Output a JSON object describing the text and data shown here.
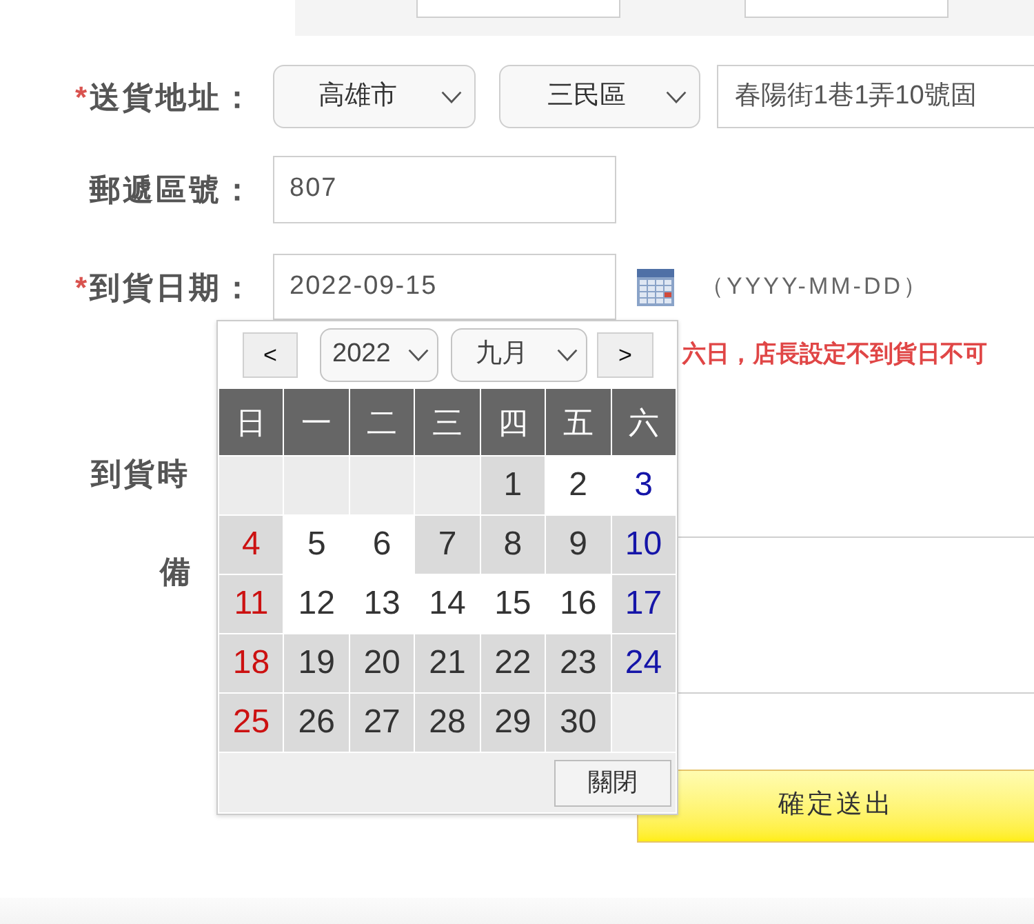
{
  "top_panel": {
    "fields": [
      {
        "kind": "text_input"
      },
      {
        "kind": "text_input"
      }
    ]
  },
  "address_row": {
    "mark": "*",
    "label": "送貨地址：",
    "city": "高雄市",
    "district": "三民區",
    "street": "春陽街1巷1弄10號固"
  },
  "postcode_row": {
    "label": "郵遞區號：",
    "value": "807"
  },
  "date_row": {
    "mark": "*",
    "label": "到貨日期：",
    "value": "2022-09-15",
    "format_hint": "（YYYY-MM-DD）"
  },
  "notice": "六日，店長設定不到貨日不可",
  "time_row": {
    "label": "到貨時"
  },
  "remarks_row": {
    "label": "備"
  },
  "submit_button": "確定送出",
  "date_picker": {
    "prev": "<",
    "year": "2022",
    "month": "九月",
    "next": ">",
    "weekdays": [
      "日",
      "一",
      "二",
      "三",
      "四",
      "五",
      "六"
    ],
    "weeks": [
      {
        "cells": [
          {
            "kind": "blank"
          },
          {
            "kind": "blank"
          },
          {
            "kind": "blank"
          },
          {
            "kind": "blank"
          },
          {
            "kind": "day",
            "label": "1",
            "disabled": true
          },
          {
            "kind": "day",
            "label": "2",
            "disabled": false
          },
          {
            "kind": "day",
            "label": "3",
            "disabled": false
          }
        ]
      },
      {
        "cells": [
          {
            "kind": "day",
            "label": "4",
            "disabled": true
          },
          {
            "kind": "day",
            "label": "5",
            "disabled": false
          },
          {
            "kind": "day",
            "label": "6",
            "disabled": false
          },
          {
            "kind": "day",
            "label": "7",
            "disabled": true
          },
          {
            "kind": "day",
            "label": "8",
            "disabled": true
          },
          {
            "kind": "day",
            "label": "9",
            "disabled": true
          },
          {
            "kind": "day",
            "label": "10",
            "disabled": true
          }
        ]
      },
      {
        "cells": [
          {
            "kind": "day",
            "label": "11",
            "disabled": true
          },
          {
            "kind": "day",
            "label": "12",
            "disabled": false
          },
          {
            "kind": "day",
            "label": "13",
            "disabled": false
          },
          {
            "kind": "day",
            "label": "14",
            "disabled": false
          },
          {
            "kind": "day",
            "label": "15",
            "disabled": false
          },
          {
            "kind": "day",
            "label": "16",
            "disabled": false
          },
          {
            "kind": "day",
            "label": "17",
            "disabled": true
          }
        ]
      },
      {
        "cells": [
          {
            "kind": "day",
            "label": "18",
            "disabled": true
          },
          {
            "kind": "day",
            "label": "19",
            "disabled": true
          },
          {
            "kind": "day",
            "label": "20",
            "disabled": true
          },
          {
            "kind": "day",
            "label": "21",
            "disabled": true
          },
          {
            "kind": "day",
            "label": "22",
            "disabled": true
          },
          {
            "kind": "day",
            "label": "23",
            "disabled": true
          },
          {
            "kind": "day",
            "label": "24",
            "disabled": true
          }
        ]
      },
      {
        "cells": [
          {
            "kind": "day",
            "label": "25",
            "disabled": true
          },
          {
            "kind": "day",
            "label": "26",
            "disabled": true
          },
          {
            "kind": "day",
            "label": "27",
            "disabled": true
          },
          {
            "kind": "day",
            "label": "28",
            "disabled": true
          },
          {
            "kind": "day",
            "label": "29",
            "disabled": true
          },
          {
            "kind": "day",
            "label": "30",
            "disabled": true
          },
          {
            "kind": "blank"
          }
        ]
      }
    ],
    "close": "關閉"
  }
}
